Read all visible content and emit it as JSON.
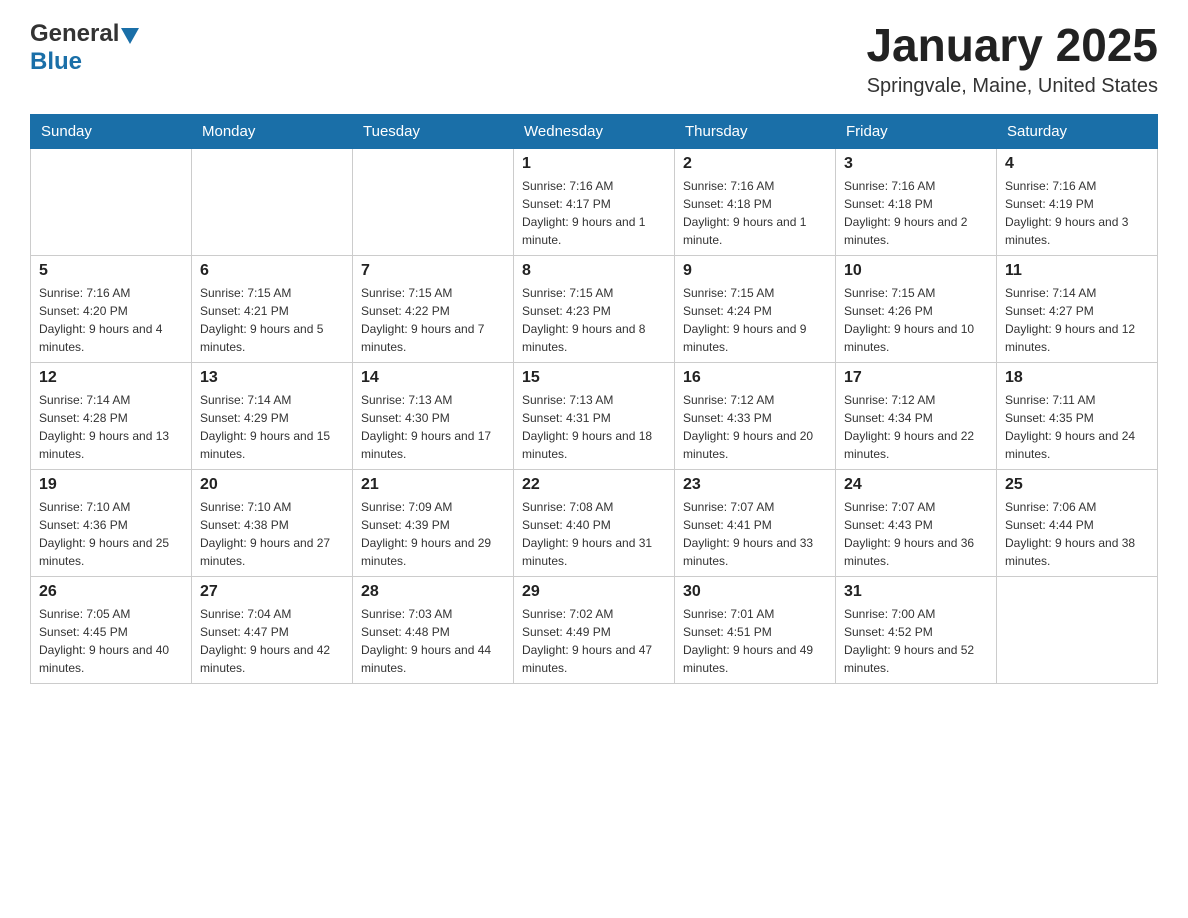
{
  "header": {
    "logo_general": "General",
    "logo_blue": "Blue",
    "title": "January 2025",
    "subtitle": "Springvale, Maine, United States"
  },
  "weekdays": [
    "Sunday",
    "Monday",
    "Tuesday",
    "Wednesday",
    "Thursday",
    "Friday",
    "Saturday"
  ],
  "weeks": [
    [
      {
        "day": "",
        "info": ""
      },
      {
        "day": "",
        "info": ""
      },
      {
        "day": "",
        "info": ""
      },
      {
        "day": "1",
        "info": "Sunrise: 7:16 AM\nSunset: 4:17 PM\nDaylight: 9 hours and 1 minute."
      },
      {
        "day": "2",
        "info": "Sunrise: 7:16 AM\nSunset: 4:18 PM\nDaylight: 9 hours and 1 minute."
      },
      {
        "day": "3",
        "info": "Sunrise: 7:16 AM\nSunset: 4:18 PM\nDaylight: 9 hours and 2 minutes."
      },
      {
        "day": "4",
        "info": "Sunrise: 7:16 AM\nSunset: 4:19 PM\nDaylight: 9 hours and 3 minutes."
      }
    ],
    [
      {
        "day": "5",
        "info": "Sunrise: 7:16 AM\nSunset: 4:20 PM\nDaylight: 9 hours and 4 minutes."
      },
      {
        "day": "6",
        "info": "Sunrise: 7:15 AM\nSunset: 4:21 PM\nDaylight: 9 hours and 5 minutes."
      },
      {
        "day": "7",
        "info": "Sunrise: 7:15 AM\nSunset: 4:22 PM\nDaylight: 9 hours and 7 minutes."
      },
      {
        "day": "8",
        "info": "Sunrise: 7:15 AM\nSunset: 4:23 PM\nDaylight: 9 hours and 8 minutes."
      },
      {
        "day": "9",
        "info": "Sunrise: 7:15 AM\nSunset: 4:24 PM\nDaylight: 9 hours and 9 minutes."
      },
      {
        "day": "10",
        "info": "Sunrise: 7:15 AM\nSunset: 4:26 PM\nDaylight: 9 hours and 10 minutes."
      },
      {
        "day": "11",
        "info": "Sunrise: 7:14 AM\nSunset: 4:27 PM\nDaylight: 9 hours and 12 minutes."
      }
    ],
    [
      {
        "day": "12",
        "info": "Sunrise: 7:14 AM\nSunset: 4:28 PM\nDaylight: 9 hours and 13 minutes."
      },
      {
        "day": "13",
        "info": "Sunrise: 7:14 AM\nSunset: 4:29 PM\nDaylight: 9 hours and 15 minutes."
      },
      {
        "day": "14",
        "info": "Sunrise: 7:13 AM\nSunset: 4:30 PM\nDaylight: 9 hours and 17 minutes."
      },
      {
        "day": "15",
        "info": "Sunrise: 7:13 AM\nSunset: 4:31 PM\nDaylight: 9 hours and 18 minutes."
      },
      {
        "day": "16",
        "info": "Sunrise: 7:12 AM\nSunset: 4:33 PM\nDaylight: 9 hours and 20 minutes."
      },
      {
        "day": "17",
        "info": "Sunrise: 7:12 AM\nSunset: 4:34 PM\nDaylight: 9 hours and 22 minutes."
      },
      {
        "day": "18",
        "info": "Sunrise: 7:11 AM\nSunset: 4:35 PM\nDaylight: 9 hours and 24 minutes."
      }
    ],
    [
      {
        "day": "19",
        "info": "Sunrise: 7:10 AM\nSunset: 4:36 PM\nDaylight: 9 hours and 25 minutes."
      },
      {
        "day": "20",
        "info": "Sunrise: 7:10 AM\nSunset: 4:38 PM\nDaylight: 9 hours and 27 minutes."
      },
      {
        "day": "21",
        "info": "Sunrise: 7:09 AM\nSunset: 4:39 PM\nDaylight: 9 hours and 29 minutes."
      },
      {
        "day": "22",
        "info": "Sunrise: 7:08 AM\nSunset: 4:40 PM\nDaylight: 9 hours and 31 minutes."
      },
      {
        "day": "23",
        "info": "Sunrise: 7:07 AM\nSunset: 4:41 PM\nDaylight: 9 hours and 33 minutes."
      },
      {
        "day": "24",
        "info": "Sunrise: 7:07 AM\nSunset: 4:43 PM\nDaylight: 9 hours and 36 minutes."
      },
      {
        "day": "25",
        "info": "Sunrise: 7:06 AM\nSunset: 4:44 PM\nDaylight: 9 hours and 38 minutes."
      }
    ],
    [
      {
        "day": "26",
        "info": "Sunrise: 7:05 AM\nSunset: 4:45 PM\nDaylight: 9 hours and 40 minutes."
      },
      {
        "day": "27",
        "info": "Sunrise: 7:04 AM\nSunset: 4:47 PM\nDaylight: 9 hours and 42 minutes."
      },
      {
        "day": "28",
        "info": "Sunrise: 7:03 AM\nSunset: 4:48 PM\nDaylight: 9 hours and 44 minutes."
      },
      {
        "day": "29",
        "info": "Sunrise: 7:02 AM\nSunset: 4:49 PM\nDaylight: 9 hours and 47 minutes."
      },
      {
        "day": "30",
        "info": "Sunrise: 7:01 AM\nSunset: 4:51 PM\nDaylight: 9 hours and 49 minutes."
      },
      {
        "day": "31",
        "info": "Sunrise: 7:00 AM\nSunset: 4:52 PM\nDaylight: 9 hours and 52 minutes."
      },
      {
        "day": "",
        "info": ""
      }
    ]
  ]
}
